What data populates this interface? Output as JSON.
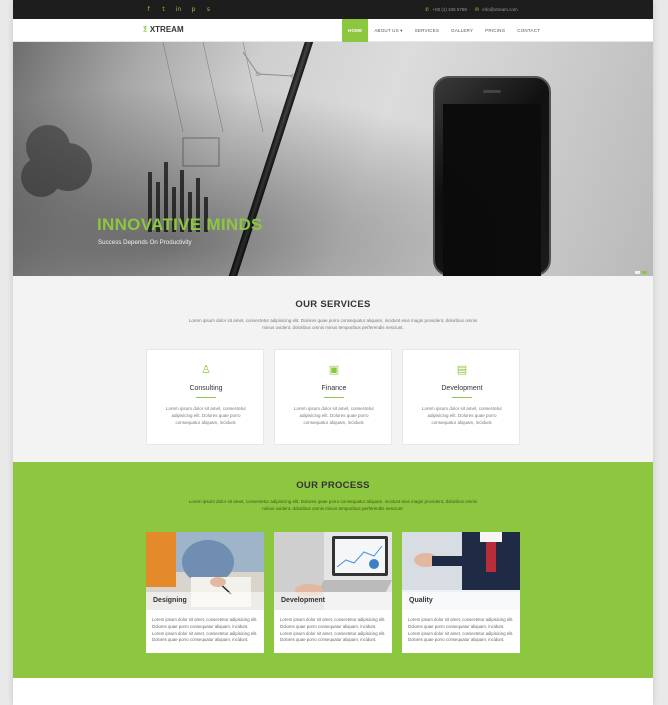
{
  "topbar": {
    "social_icons": [
      "facebook-icon",
      "twitter-icon",
      "linkedin-icon",
      "pinterest-icon",
      "skype-icon"
    ],
    "social_glyphs": [
      "f",
      "t",
      "in",
      "p",
      "s"
    ],
    "phone": "+00 (1) 345 6789",
    "email": "info@xtream.com"
  },
  "header": {
    "logo_mark": "Ⲝ",
    "logo_text": "XTREAM",
    "nav": [
      "HOME",
      "ABOUT US ▾",
      "SERVICES",
      "GALLERY",
      "PRICING",
      "CONTACT"
    ],
    "active_nav": "HOME"
  },
  "hero": {
    "title": "INNOVATIVE MINDS",
    "subtitle": "Success Depends On Productivity"
  },
  "services": {
    "title": "OUR SERVICES",
    "description": "Lorem ipsum dolor sit amet, consectetur adipisicing elit. Dolores quae porro consequatur aliquam, incidunt eius magni provident, doloribus omnis minus ovident, doloribus omnis minus temporibus perferendis nesciunt.",
    "cards": [
      {
        "icon": "person-icon",
        "glyph": "♙",
        "title": "Consulting",
        "text": "Lorem ipsum dolor sit amet, consectetur adipisicing elit. Dolores quae porro consequatur aliquam, incidunt."
      },
      {
        "icon": "briefcase-icon",
        "glyph": "▣",
        "title": "Finance",
        "text": "Lorem ipsum dolor sit amet, consectetur adipisicing elit. Dolores quae porro consequatur aliquam, incidunt."
      },
      {
        "icon": "devices-icon",
        "glyph": "▤",
        "title": "Development",
        "text": "Lorem ipsum dolor sit amet, consectetur adipisicing elit. Dolores quae porro consequatur aliquam, incidunt."
      }
    ]
  },
  "process": {
    "title": "OUR PROCESS",
    "description": "Lorem ipsum dolor sit amet, consectetur adipisicing elit. Dolores quae porro consequatur aliquam, incidunt eius magni provident, doloribus omnis minus ovident, doloribus omnis minus temporibus perferendis nesciunt.",
    "cards": [
      {
        "label": "Designing",
        "text": "Lorem ipsum dolor sit amet, consectetur adipisicing elit. Dolores quae porro consequatur aliquam, incidunt. Lorem ipsum dolor sit amet, consectetur adipisicing elit. Dolores quae porro consequatur aliquam, incidunt."
      },
      {
        "label": "Development",
        "text": "Lorem ipsum dolor sit amet, consectetur adipisicing elit. Dolores quae porro consequatur aliquam, incidunt. Lorem ipsum dolor sit amet, consectetur adipisicing elit. Dolores quae porro consequatur aliquam, incidunt."
      },
      {
        "label": "Quality",
        "text": "Lorem ipsum dolor sit amet, consectetur adipisicing elit. Dolores quae porro consequatur aliquam, incidunt. Lorem ipsum dolor sit amet, consectetur adipisicing elit. Dolores quae porro consequatur aliquam, incidunt."
      }
    ]
  },
  "colors": {
    "accent": "#8dc63f",
    "topbar": "#1d1d1d",
    "page_bg": "#f3f3f3"
  }
}
